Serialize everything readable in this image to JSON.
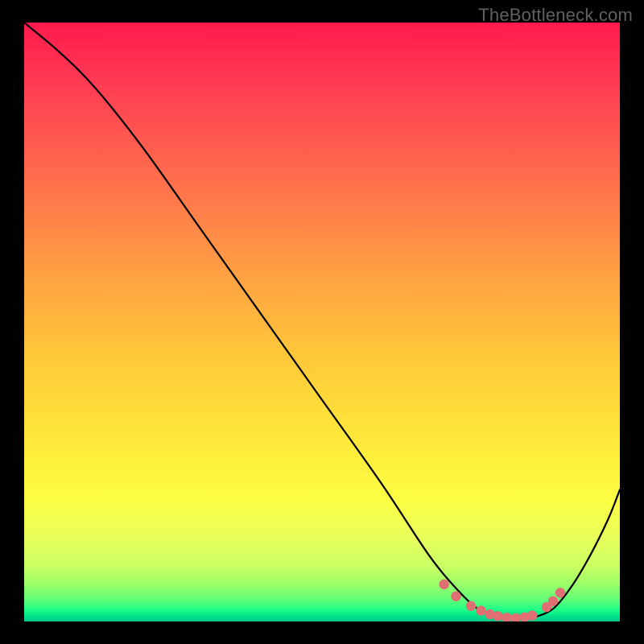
{
  "watermark": "TheBottleneck.com",
  "chart_data": {
    "type": "line",
    "title": "",
    "xlabel": "",
    "ylabel": "",
    "xlim": [
      0,
      100
    ],
    "ylim": [
      0,
      100
    ],
    "grid": false,
    "series": [
      {
        "name": "curve",
        "x": [
          0,
          6,
          12,
          20,
          30,
          40,
          50,
          60,
          68,
          73,
          76,
          78,
          80,
          82,
          84,
          86,
          89,
          92,
          95,
          98,
          100
        ],
        "y": [
          100,
          95,
          89,
          79,
          65,
          51,
          37,
          23,
          11,
          5,
          2.2,
          1.2,
          0.6,
          0.4,
          0.4,
          0.8,
          2.3,
          6.0,
          11,
          17,
          22
        ]
      }
    ],
    "markers": {
      "name": "valley-dots",
      "color": "#e06e72",
      "points": [
        {
          "x": 70.5,
          "y": 6.2
        },
        {
          "x": 72.5,
          "y": 4.2
        },
        {
          "x": 75.0,
          "y": 2.6
        },
        {
          "x": 76.7,
          "y": 1.8
        },
        {
          "x": 78.2,
          "y": 1.2
        },
        {
          "x": 79.5,
          "y": 0.9
        },
        {
          "x": 81.0,
          "y": 0.65
        },
        {
          "x": 82.5,
          "y": 0.55
        },
        {
          "x": 84.0,
          "y": 0.7
        },
        {
          "x": 85.3,
          "y": 1.0
        },
        {
          "x": 87.7,
          "y": 2.4
        },
        {
          "x": 88.8,
          "y": 3.4
        },
        {
          "x": 90.0,
          "y": 4.8
        }
      ]
    }
  }
}
